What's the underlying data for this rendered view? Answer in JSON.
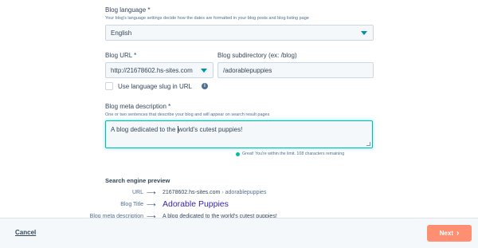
{
  "language": {
    "label": "Blog language *",
    "help": "Your blog's language settings decide how the dates are formatted in your blog posts and blog listing page",
    "selected": "English"
  },
  "url": {
    "label": "Blog URL *",
    "selected": "http://21678602.hs-sites.com"
  },
  "subdirectory": {
    "label": "Blog subdirectory (ex: /blog)",
    "value": "/adorablepuppies"
  },
  "slug": {
    "label": "Use language slug in URL",
    "checked": false
  },
  "meta": {
    "label": "Blog meta description *",
    "help": "One or two sentences that describe your blog and will appear on search result pages",
    "value_before_cursor": "A blog dedicated to the ",
    "value_after_cursor": "world's cutest puppies!",
    "status": "Great! You're within the limit. 108 characters remaining"
  },
  "preview": {
    "heading": "Search engine preview",
    "url_key": "URL",
    "url_domain": "21678602.hs-sites.com",
    "url_sep": "›",
    "url_path": "adorablepuppies",
    "title_key": "Blog Title",
    "title_value": "Adorable Puppies",
    "meta_key": "Blog meta description",
    "meta_value": "A blog dedicated to the world's cutest puppies!",
    "arrow": "⟶"
  },
  "footer": {
    "cancel_label": "Cancel",
    "next_label": "Next",
    "next_icon": "›"
  },
  "colors": {
    "accent": "#00bda5",
    "caret": "#0091ae",
    "next": "#ff8f73",
    "title_link": "#3a23ad"
  }
}
